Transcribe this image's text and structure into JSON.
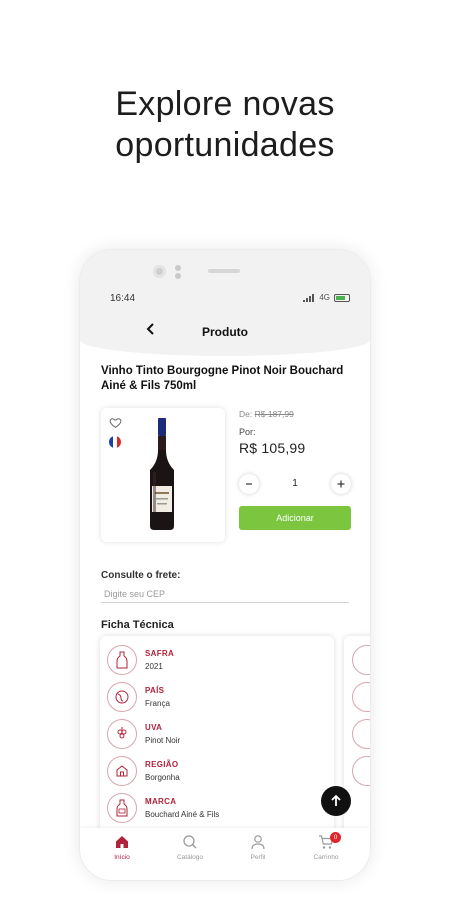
{
  "headline": {
    "line1": "Explore novas",
    "line2": "oportunidades"
  },
  "status_bar": {
    "time": "16:44",
    "network": "4G"
  },
  "header": {
    "title": "Produto",
    "back_icon": "chevron-left-icon"
  },
  "product": {
    "name": "Vinho Tinto Bourgogne Pinot Noir Bouchard  Ainé & Fils 750ml",
    "old_price_prefix": "De:",
    "old_price": "R$ 187,99",
    "price_prefix": "Por:",
    "price": "R$ 105,99",
    "quantity": "1",
    "add_button": "Adicionar",
    "origin_flag": "France"
  },
  "shipping": {
    "label": "Consulte o frete:",
    "placeholder": "Digite seu CEP"
  },
  "ficha": {
    "title": "Ficha Técnica",
    "items": [
      {
        "label": "SAFRA",
        "value": "2021",
        "icon": "wine-bottle-icon"
      },
      {
        "label": "PAÍS",
        "value": "França",
        "icon": "globe-icon"
      },
      {
        "label": "UVA",
        "value": "Pinot Noir",
        "icon": "grapes-icon"
      },
      {
        "label": "REGIÃO",
        "value": "Borgonha",
        "icon": "region-icon"
      },
      {
        "label": "MARCA",
        "value": "Bouchard Ainé & Fils",
        "icon": "bottle-brand-icon"
      }
    ]
  },
  "bottom_nav": {
    "items": [
      {
        "label": "Início",
        "icon": "home-icon",
        "active": true
      },
      {
        "label": "Catálogo",
        "icon": "search-icon",
        "active": false
      },
      {
        "label": "Perfil",
        "icon": "user-icon",
        "active": false
      },
      {
        "label": "Carrinho",
        "icon": "cart-icon",
        "active": false
      }
    ],
    "cart_count": "0"
  },
  "colors": {
    "accent": "#b0223a",
    "add_button": "#7bc53f",
    "badge": "#e0242c"
  }
}
